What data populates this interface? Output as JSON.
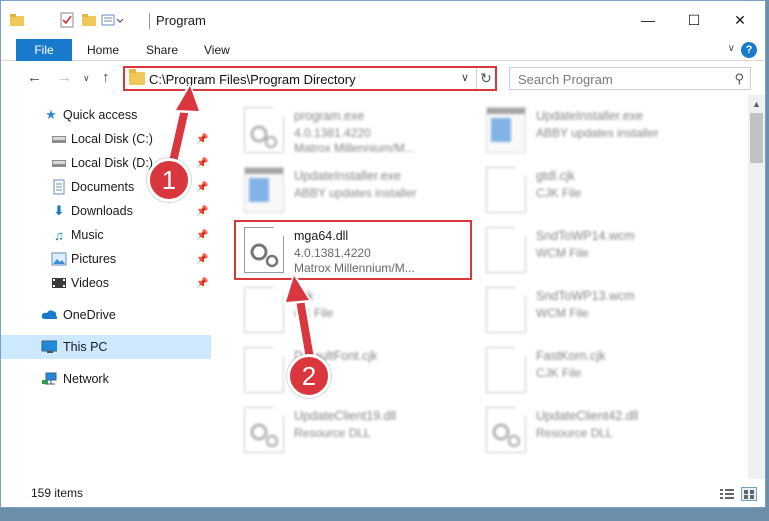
{
  "window": {
    "title": "Program"
  },
  "ribbon": {
    "tabs": [
      "File",
      "Home",
      "Share",
      "View"
    ]
  },
  "address_bar": {
    "path": "C:\\Program Files\\Program Directory",
    "search_placeholder": "Search Program"
  },
  "sidebar": {
    "items": [
      {
        "label": "Quick access",
        "icon": "star-icon"
      },
      {
        "label": "Local Disk (C:)",
        "icon": "drive-icon",
        "pinned": true
      },
      {
        "label": "Local Disk (D:)",
        "icon": "drive-icon",
        "pinned": true
      },
      {
        "label": "Documents",
        "icon": "documents-icon",
        "pinned": true
      },
      {
        "label": "Downloads",
        "icon": "download-icon",
        "pinned": true
      },
      {
        "label": "Music",
        "icon": "music-icon",
        "pinned": true
      },
      {
        "label": "Pictures",
        "icon": "pictures-icon",
        "pinned": true
      },
      {
        "label": "Videos",
        "icon": "videos-icon",
        "pinned": true
      },
      {
        "label": "OneDrive",
        "icon": "cloud-icon"
      },
      {
        "label": "This PC",
        "icon": "computer-icon",
        "selected": true
      },
      {
        "label": "Network",
        "icon": "network-icon"
      }
    ]
  },
  "files": {
    "left": [
      {
        "name": "program.exe",
        "line1": "4.0.1381.4220",
        "line2": "Matrox Millennium/M...",
        "type": "gear"
      },
      {
        "name": "UpdateInstaller.exe",
        "line1": "ABBY updates installer",
        "line2": "",
        "type": "app"
      },
      {
        "name": "mga64.dll",
        "line1": "4.0.1381.4220",
        "line2": "Matrox Millennium/M...",
        "type": "gear",
        "highlighted": true
      },
      {
        "name": "gck",
        "line1": "CK File",
        "line2": "",
        "type": "doc"
      },
      {
        "name": "DefaultFont.cjk",
        "line1": "",
        "line2": "",
        "type": "doc"
      },
      {
        "name": "UpdateClient19.dll",
        "line1": "Resource DLL",
        "line2": "",
        "type": "gear"
      }
    ],
    "right": [
      {
        "name": "UpdateInstaller.exe",
        "line1": "ABBY updates installer",
        "type": "app"
      },
      {
        "name": "gtdl.cjk",
        "line1": "CJK File",
        "type": "doc"
      },
      {
        "name": "SndToWP14.wcm",
        "line1": "WCM File",
        "type": "doc"
      },
      {
        "name": "SndToWP13.wcm",
        "line1": "WCM File",
        "type": "doc"
      },
      {
        "name": "FastKorn.cjk",
        "line1": "CJK File",
        "type": "doc"
      },
      {
        "name": "UpdateClient42.dll",
        "line1": "Resource DLL",
        "type": "gear"
      }
    ]
  },
  "status": {
    "item_count": "159 items"
  },
  "callouts": [
    "1",
    "2"
  ],
  "colors": {
    "accent": "#1979ca",
    "highlight": "#d9363e",
    "selected_bg": "#cde8ff"
  }
}
